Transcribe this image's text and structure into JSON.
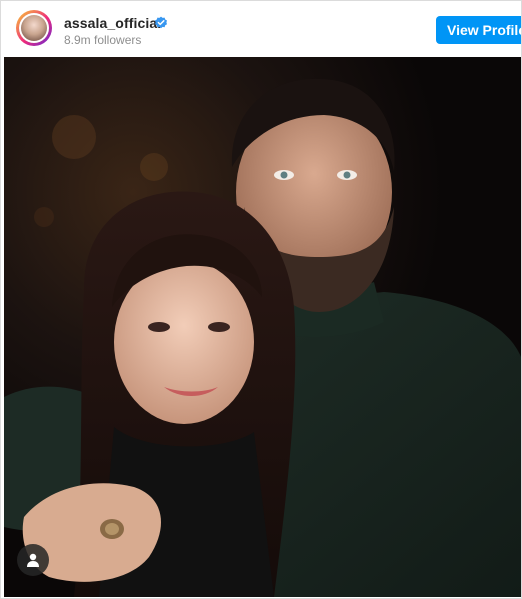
{
  "profile": {
    "username": "assala_official",
    "followers": "8.9m followers",
    "verified": true,
    "avatar_icon": "profile-avatar"
  },
  "actions": {
    "view_profile_label": "View Profile"
  },
  "post": {
    "image_icon": "post-photo",
    "tag_icon": "user-tag-icon"
  },
  "colors": {
    "accent": "#0095f6",
    "text_primary": "#262626",
    "text_secondary": "#8e8e8e",
    "border": "#dbdbdb"
  }
}
